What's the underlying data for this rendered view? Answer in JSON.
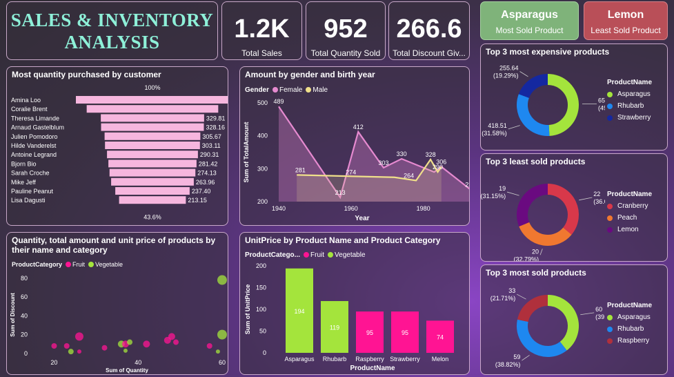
{
  "title": {
    "line1": "SALES & INVENTORY",
    "line2": "ANALYSIS"
  },
  "kpis": [
    {
      "value": "1.2K",
      "label": "Total Sales"
    },
    {
      "value": "952",
      "label": "Total Quantity Sold"
    },
    {
      "value": "266.6",
      "label": "Total Discount Giv..."
    }
  ],
  "most_sold": {
    "name": "Asparagus",
    "label": "Most Sold Product"
  },
  "least_sold": {
    "name": "Lemon",
    "label": "Least Sold Product"
  },
  "colors": {
    "fruit": "#ff1493",
    "vegetable": "#a4e43c",
    "female": "#e68ad0",
    "male": "#f0e08a",
    "funnel": "#f6b6de"
  },
  "customers": {
    "title": "Most quantity purchased by customer",
    "top_pct": "100%",
    "bottom_pct": "43.6%",
    "chart_data": {
      "type": "bar",
      "categories": [
        "Amina Loo",
        "Coralie Brent",
        "Theresa Limande",
        "Arnaud Gastelblum",
        "Julien Pomodoro",
        "Hilde Vanderelst",
        "Antoine Legrand",
        "Bjorn Bio",
        "Sarah Croche",
        "Mike Jeff",
        "Pauline Peanut",
        "Lisa Dagusti"
      ],
      "values": [
        489,
        420,
        329.81,
        328.16,
        305.67,
        303.11,
        290.31,
        281.42,
        274.13,
        263.96,
        237.4,
        213.15
      ],
      "labels": [
        "",
        "",
        "329.81",
        "328.16",
        "305.67",
        "303.11",
        "290.31",
        "281.42",
        "274.13",
        "263.96",
        "237.40",
        "213.15"
      ]
    }
  },
  "gender": {
    "title": "Amount by gender and birth year",
    "legend_title": "Gender",
    "female": "Female",
    "male": "Male",
    "xlabel": "Year",
    "ylabel": "Sum of TotalAmount",
    "chart_data": {
      "type": "area",
      "ylim": [
        200,
        500
      ],
      "yticks": [
        200,
        300,
        400,
        500
      ],
      "xlim": [
        1940,
        1990
      ],
      "xticks": [
        1940,
        1960,
        1980
      ],
      "series": [
        {
          "name": "Female",
          "x": [
            1940,
            1957,
            1962,
            1969,
            1974,
            1983,
            1985,
            1993
          ],
          "y": [
            489,
            213,
            412,
            303,
            330,
            290,
            306,
            237
          ]
        },
        {
          "name": "Male",
          "x": [
            1945,
            1972,
            1978,
            1982,
            1984,
            1985
          ],
          "y": [
            281,
            274,
            264,
            328,
            290,
            306
          ]
        }
      ],
      "labels": [
        {
          "text": "489",
          "x": 1940,
          "y": 489
        },
        {
          "text": "281",
          "x": 1946,
          "y": 281
        },
        {
          "text": "213",
          "x": 1957,
          "y": 213
        },
        {
          "text": "274",
          "x": 1960,
          "y": 274
        },
        {
          "text": "412",
          "x": 1962,
          "y": 412
        },
        {
          "text": "303",
          "x": 1969,
          "y": 303
        },
        {
          "text": "330",
          "x": 1974,
          "y": 330
        },
        {
          "text": "264",
          "x": 1976,
          "y": 264
        },
        {
          "text": "328",
          "x": 1982,
          "y": 328
        },
        {
          "text": "290",
          "x": 1984,
          "y": 290
        },
        {
          "text": "306",
          "x": 1985,
          "y": 306
        },
        {
          "text": "237",
          "x": 1993,
          "y": 237
        }
      ]
    }
  },
  "scatter": {
    "title1": "Quantity, total amount and unit price of products by",
    "title2": "their name and category",
    "legend_title": "ProductCategory",
    "fruit": "Fruit",
    "vegetable": "Vegetable",
    "xlabel": "Sum of Quantity",
    "ylabel": "Sum of Discount",
    "chart_data": {
      "type": "scatter",
      "xlim": [
        15,
        60
      ],
      "ylim": [
        -3,
        85
      ],
      "xticks": [
        20,
        40,
        60
      ],
      "yticks": [
        0,
        20,
        40,
        60,
        80
      ],
      "points": [
        {
          "x": 60,
          "y": 78,
          "cat": "Vegetable",
          "r": 7
        },
        {
          "x": 60,
          "y": 20,
          "cat": "Vegetable",
          "r": 7
        },
        {
          "x": 26,
          "y": 18,
          "cat": "Fruit",
          "r": 6
        },
        {
          "x": 20,
          "y": 8,
          "cat": "Fruit",
          "r": 4
        },
        {
          "x": 23,
          "y": 8,
          "cat": "Fruit",
          "r": 4
        },
        {
          "x": 24,
          "y": 2,
          "cat": "Vegetable",
          "r": 4
        },
        {
          "x": 26,
          "y": 2,
          "cat": "Fruit",
          "r": 3
        },
        {
          "x": 32,
          "y": 6,
          "cat": "Fruit",
          "r": 4
        },
        {
          "x": 36,
          "y": 10,
          "cat": "Vegetable",
          "r": 5
        },
        {
          "x": 37,
          "y": 10,
          "cat": "Fruit",
          "r": 5
        },
        {
          "x": 38,
          "y": 12,
          "cat": "Vegetable",
          "r": 4
        },
        {
          "x": 37,
          "y": 3,
          "cat": "Vegetable",
          "r": 3
        },
        {
          "x": 42,
          "y": 10,
          "cat": "Fruit",
          "r": 5
        },
        {
          "x": 47,
          "y": 14,
          "cat": "Fruit",
          "r": 5
        },
        {
          "x": 48,
          "y": 18,
          "cat": "Fruit",
          "r": 5
        },
        {
          "x": 49,
          "y": 12,
          "cat": "Fruit",
          "r": 4
        },
        {
          "x": 57,
          "y": 8,
          "cat": "Fruit",
          "r": 4
        },
        {
          "x": 59,
          "y": 2,
          "cat": "Vegetable",
          "r": 3
        }
      ]
    }
  },
  "unitprice": {
    "title": "UnitPrice by Product Name and Product Category",
    "legend_title": "ProductCatego...",
    "fruit": "Fruit",
    "vegetable": "Vegetable",
    "xlabel": "ProductName",
    "ylabel": "Sum of UnitPrice",
    "chart_data": {
      "type": "bar",
      "ylim": [
        0,
        200
      ],
      "yticks": [
        0,
        50,
        100,
        150,
        200
      ],
      "categories": [
        "Asparagus",
        "Rhubarb",
        "Raspberry",
        "Strawberry",
        "Melon"
      ],
      "values": [
        194,
        119,
        95,
        95,
        74
      ],
      "category_type": [
        "Vegetable",
        "Vegetable",
        "Fruit",
        "Fruit",
        "Fruit"
      ]
    }
  },
  "expensive": {
    "title": "Top 3 most expensive products",
    "legend_title": "ProductName",
    "chart_data": {
      "type": "pie",
      "items": [
        {
          "name": "Asparagus",
          "value": 651.05,
          "pct": "(49.13%)",
          "color": "#a4e43c"
        },
        {
          "name": "Rhubarb",
          "value": 418.51,
          "pct": "(31.58%)",
          "color": "#1e88f0"
        },
        {
          "name": "Strawberry",
          "value": 255.64,
          "pct": "(19.29%)",
          "color": "#1428a0"
        }
      ]
    }
  },
  "least": {
    "title": "Top 3 least sold products",
    "legend_title": "ProductName",
    "chart_data": {
      "type": "pie",
      "items": [
        {
          "name": "Cranberry",
          "value": 22,
          "pct": "(36.07%)",
          "color": "#d8384a"
        },
        {
          "name": "Peach",
          "value": 20,
          "pct": "(32.79%)",
          "color": "#f07830"
        },
        {
          "name": "Lemon",
          "value": 19,
          "pct": "(31.15%)",
          "color": "#6a0a80"
        }
      ]
    }
  },
  "mostsold": {
    "title": "Top 3 most sold products",
    "legend_title": "ProductName",
    "chart_data": {
      "type": "pie",
      "items": [
        {
          "name": "Asparagus",
          "value": 60,
          "pct": "(39.47%)",
          "color": "#a4e43c"
        },
        {
          "name": "Rhubarb",
          "value": 59,
          "pct": "(38.82%)",
          "color": "#1e88f0"
        },
        {
          "name": "Raspberry",
          "value": 33,
          "pct": "(21.71%)",
          "color": "#b0303c"
        }
      ]
    }
  }
}
